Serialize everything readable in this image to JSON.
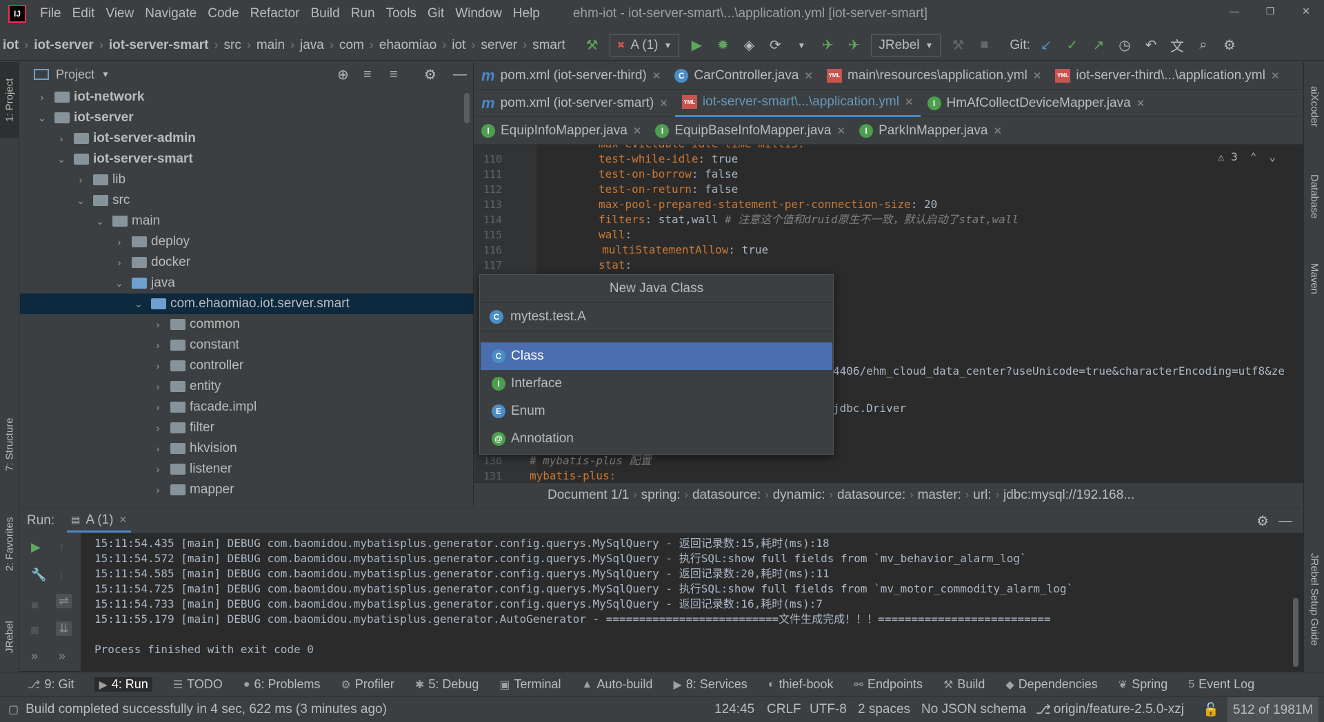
{
  "app": {
    "logo": "IJ",
    "title": "ehm-iot - iot-server-smart\\...\\application.yml [iot-server-smart]",
    "menu": [
      "File",
      "Edit",
      "View",
      "Navigate",
      "Code",
      "Refactor",
      "Build",
      "Run",
      "Tools",
      "Git",
      "Window",
      "Help"
    ]
  },
  "navbar": {
    "crumbs": [
      "iot",
      "iot-server",
      "iot-server-smart",
      "src",
      "main",
      "java",
      "com",
      "ehaomiao",
      "iot",
      "server",
      "smart"
    ],
    "run_config": "A (1)",
    "jrebel": "JRebel",
    "git_label": "Git:"
  },
  "left_strip": {
    "project": "1: Project",
    "structure": "7: Structure",
    "favorites": "2: Favorites",
    "jrebel": "JRebel"
  },
  "right_strip": {
    "aixcoder": "aiXcoder",
    "database": "Database",
    "maven": "Maven",
    "jrebel_setup": "JRebel Setup Guide"
  },
  "project": {
    "title": "Project",
    "tree": [
      {
        "label": "iot-network",
        "bold": true,
        "expanded": false,
        "selected": false
      },
      {
        "label": "iot-server",
        "bold": true,
        "expanded": true,
        "selected": false
      },
      {
        "label": "iot-server-admin",
        "bold": true,
        "expanded": false,
        "selected": false
      },
      {
        "label": "iot-server-smart",
        "bold": true,
        "expanded": true,
        "selected": false
      },
      {
        "label": "lib",
        "bold": false,
        "expanded": false,
        "selected": false
      },
      {
        "label": "src",
        "bold": false,
        "expanded": true,
        "selected": false
      },
      {
        "label": "main",
        "bold": false,
        "expanded": true,
        "selected": false
      },
      {
        "label": "deploy",
        "bold": false,
        "expanded": false,
        "selected": false
      },
      {
        "label": "docker",
        "bold": false,
        "expanded": false,
        "selected": false
      },
      {
        "label": "java",
        "bold": false,
        "expanded": true,
        "selected": false
      },
      {
        "label": "com.ehaomiao.iot.server.smart",
        "bold": false,
        "expanded": true,
        "selected": true
      },
      {
        "label": "common",
        "bold": false,
        "expanded": false,
        "selected": false
      },
      {
        "label": "constant",
        "bold": false,
        "expanded": false,
        "selected": false
      },
      {
        "label": "controller",
        "bold": false,
        "expanded": false,
        "selected": false
      },
      {
        "label": "entity",
        "bold": false,
        "expanded": false,
        "selected": false
      },
      {
        "label": "facade.impl",
        "bold": false,
        "expanded": false,
        "selected": false
      },
      {
        "label": "filter",
        "bold": false,
        "expanded": false,
        "selected": false
      },
      {
        "label": "hkvision",
        "bold": false,
        "expanded": false,
        "selected": false
      },
      {
        "label": "listener",
        "bold": false,
        "expanded": false,
        "selected": false
      },
      {
        "label": "mapper",
        "bold": false,
        "expanded": false,
        "selected": false
      }
    ]
  },
  "tabs": {
    "row1": [
      {
        "label": "pom.xml (iot-server-third)",
        "kind": "m"
      },
      {
        "label": "CarController.java",
        "kind": "c"
      },
      {
        "label": "main\\resources\\application.yml",
        "kind": "yml"
      },
      {
        "label": "iot-server-third\\...\\application.yml",
        "kind": "yml"
      }
    ],
    "row2": [
      {
        "label": "pom.xml (iot-server-smart)",
        "kind": "m"
      },
      {
        "label": "iot-server-smart\\...\\application.yml",
        "kind": "yml",
        "active": true
      },
      {
        "label": "HmAfCollectDeviceMapper.java",
        "kind": "i"
      }
    ],
    "row3": [
      {
        "label": "EquipInfoMapper.java",
        "kind": "i"
      },
      {
        "label": "EquipBaseInfoMapper.java",
        "kind": "i"
      },
      {
        "label": "ParkInMapper.java",
        "kind": "i"
      }
    ]
  },
  "editor": {
    "warnings": "3",
    "lines": [
      {
        "n": "110",
        "key": "test-while-idle",
        "value": " true",
        "comment": ""
      },
      {
        "n": "111",
        "key": "test-on-borrow",
        "value": " false",
        "comment": ""
      },
      {
        "n": "112",
        "key": "test-on-return",
        "value": " false",
        "comment": ""
      },
      {
        "n": "113",
        "key": "max-pool-prepared-statement-per-connection-size",
        "value": " 20",
        "comment": ""
      },
      {
        "n": "114",
        "key": "filters",
        "value": " stat,wall ",
        "comment": "# 注意这个值和druid原生不一致，默认启动了stat,wall"
      },
      {
        "n": "115",
        "key": "wall",
        "value": "",
        "comment": ""
      },
      {
        "n": "116",
        "key": "  multiStatementAllow",
        "value": " true",
        "comment": ""
      },
      {
        "n": "117",
        "key": "stat",
        "value": "",
        "comment": ""
      }
    ],
    "partial_top": "max-evictable-idle-time-millis:",
    "url_fragment": "4406/ehm_cloud_data_center?useUnicode=true&characterEncoding=utf8&ze",
    "driver_fragment": "jdbc.Driver",
    "line130": {
      "n": "130",
      "comment": "# mybatis-plus 配置"
    },
    "line131": {
      "n": "131",
      "key": "mybatis-plus:"
    }
  },
  "popup": {
    "title": "New Java Class",
    "input": "mytest.test.A",
    "items": [
      {
        "label": "Class",
        "icon": "C",
        "color": "#4a8ec7",
        "selected": true
      },
      {
        "label": "Interface",
        "icon": "I",
        "color": "#4c9f4e",
        "selected": false
      },
      {
        "label": "Enum",
        "icon": "E",
        "color": "#4a8ec7",
        "selected": false
      },
      {
        "label": "Annotation",
        "icon": "@",
        "color": "#4c9f4e",
        "selected": false
      }
    ]
  },
  "editor_crumbs": [
    "Document 1/1",
    "spring:",
    "datasource:",
    "dynamic:",
    "datasource:",
    "master:",
    "url:",
    "jdbc:mysql://192.168..."
  ],
  "run": {
    "label": "Run:",
    "tab": "A (1)",
    "lines": [
      "15:11:54.435 [main] DEBUG com.baomidou.mybatisplus.generator.config.querys.MySqlQuery - 返回记录数:15,耗时(ms):18",
      "15:11:54.572 [main] DEBUG com.baomidou.mybatisplus.generator.config.querys.MySqlQuery - 执行SQL:show full fields from `mv_behavior_alarm_log`",
      "15:11:54.585 [main] DEBUG com.baomidou.mybatisplus.generator.config.querys.MySqlQuery - 返回记录数:20,耗时(ms):11",
      "15:11:54.725 [main] DEBUG com.baomidou.mybatisplus.generator.config.querys.MySqlQuery - 执行SQL:show full fields from `mv_motor_commodity_alarm_log`",
      "15:11:54.733 [main] DEBUG com.baomidou.mybatisplus.generator.config.querys.MySqlQuery - 返回记录数:16,耗时(ms):7",
      "15:11:55.179 [main] DEBUG com.baomidou.mybatisplus.generator.AutoGenerator - ==========================文件生成完成！！！==========================",
      "",
      "Process finished with exit code 0"
    ]
  },
  "bottombar": [
    {
      "label": "9: Git",
      "icon": "⎇",
      "active": false
    },
    {
      "label": "4: Run",
      "icon": "▶",
      "active": true
    },
    {
      "label": "TODO",
      "icon": "☰",
      "active": false
    },
    {
      "label": "6: Problems",
      "icon": "●",
      "active": false
    },
    {
      "label": "Profiler",
      "icon": "⚙",
      "active": false
    },
    {
      "label": "5: Debug",
      "icon": "✱",
      "active": false
    },
    {
      "label": "Terminal",
      "icon": "▣",
      "active": false
    },
    {
      "label": "Auto-build",
      "icon": "▲",
      "active": false
    },
    {
      "label": "8: Services",
      "icon": "▶",
      "active": false
    },
    {
      "label": "thief-book",
      "icon": "◐",
      "active": false
    },
    {
      "label": "Endpoints",
      "icon": "⚯",
      "active": false
    },
    {
      "label": "Build",
      "icon": "⚒",
      "active": false
    },
    {
      "label": "Dependencies",
      "icon": "◆",
      "active": false
    },
    {
      "label": "Spring",
      "icon": "❦",
      "active": false
    },
    {
      "label": "Event Log",
      "icon": "5",
      "active": false
    }
  ],
  "status": {
    "message": "Build completed successfully in 4 sec, 622 ms (3 minutes ago)",
    "position": "124:45",
    "line_sep": "CRLF",
    "encoding": "UTF-8",
    "indent": "2 spaces",
    "schema": "No JSON schema",
    "branch": "origin/feature-2.5.0-xzj",
    "memory": "512 of 1981M"
  }
}
